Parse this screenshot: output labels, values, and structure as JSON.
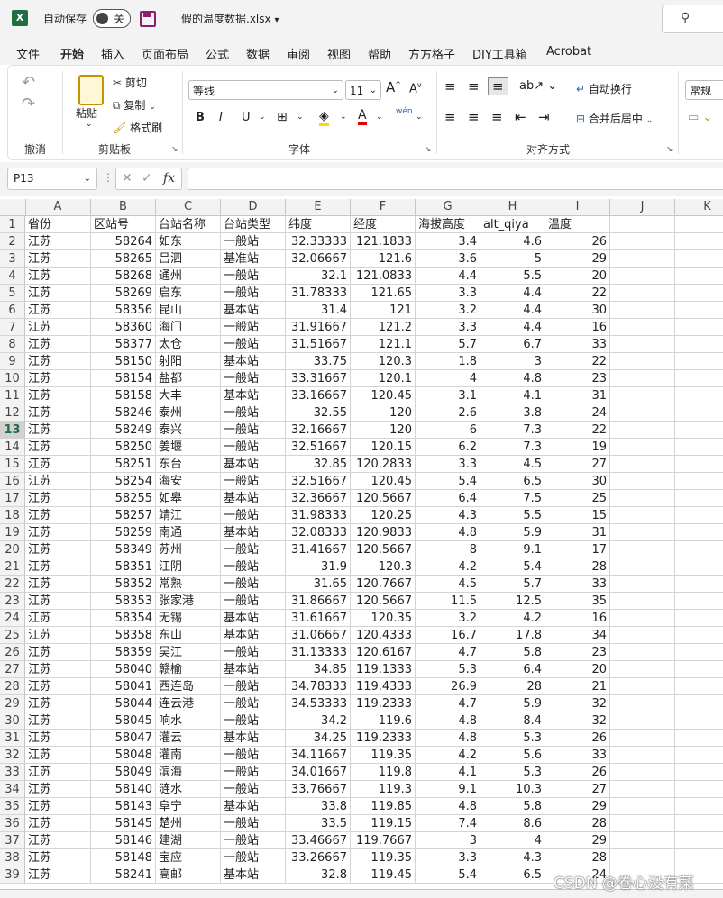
{
  "titlebar": {
    "app_icon": "X",
    "autosave_label": "自动保存",
    "autosave_state": "关",
    "filename": "假的温度数据.xlsx",
    "filename_dropdown": "▾",
    "search_icon": "⚲"
  },
  "menu_tabs": [
    "文件",
    "开始",
    "插入",
    "页面布局",
    "公式",
    "数据",
    "审阅",
    "视图",
    "帮助",
    "方方格子",
    "DIY工具箱",
    "Acrobat"
  ],
  "active_tab": "开始",
  "ribbon": {
    "undo_group": "撤消",
    "clipboard": {
      "paste": "粘贴",
      "cut": "剪切",
      "copy": "复制",
      "format_painter": "格式刷",
      "label": "剪贴板"
    },
    "font": {
      "name": "等线",
      "size": "11",
      "label": "字体",
      "bold": "B",
      "italic": "I",
      "underline": "U",
      "wen": "wén"
    },
    "alignment": {
      "wrap": "自动换行",
      "merge": "合并后居中",
      "label": "对齐方式"
    },
    "number": {
      "format": "常规"
    }
  },
  "formula_bar": {
    "name_box": "P13",
    "fx": "fx",
    "formula": ""
  },
  "columns": [
    "A",
    "B",
    "C",
    "D",
    "E",
    "F",
    "G",
    "H",
    "I",
    "J",
    "K"
  ],
  "selected_row": 13,
  "header_row": [
    "省份",
    "区站号",
    "台站名称",
    "台站类型",
    "纬度",
    "经度",
    "海拔高度",
    "alt_qiya",
    "温度"
  ],
  "rows": [
    [
      "江苏",
      "58264",
      "如东",
      "一般站",
      "32.33333",
      "121.1833",
      "3.4",
      "4.6",
      "26"
    ],
    [
      "江苏",
      "58265",
      "吕泗",
      "基准站",
      "32.06667",
      "121.6",
      "3.6",
      "5",
      "29"
    ],
    [
      "江苏",
      "58268",
      "通州",
      "一般站",
      "32.1",
      "121.0833",
      "4.4",
      "5.5",
      "20"
    ],
    [
      "江苏",
      "58269",
      "启东",
      "一般站",
      "31.78333",
      "121.65",
      "3.3",
      "4.4",
      "22"
    ],
    [
      "江苏",
      "58356",
      "昆山",
      "基本站",
      "31.4",
      "121",
      "3.2",
      "4.4",
      "30"
    ],
    [
      "江苏",
      "58360",
      "海门",
      "一般站",
      "31.91667",
      "121.2",
      "3.3",
      "4.4",
      "16"
    ],
    [
      "江苏",
      "58377",
      "太仓",
      "一般站",
      "31.51667",
      "121.1",
      "5.7",
      "6.7",
      "33"
    ],
    [
      "江苏",
      "58150",
      "射阳",
      "基本站",
      "33.75",
      "120.3",
      "1.8",
      "3",
      "22"
    ],
    [
      "江苏",
      "58154",
      "盐都",
      "一般站",
      "33.31667",
      "120.1",
      "4",
      "4.8",
      "23"
    ],
    [
      "江苏",
      "58158",
      "大丰",
      "基本站",
      "33.16667",
      "120.45",
      "3.1",
      "4.1",
      "31"
    ],
    [
      "江苏",
      "58246",
      "泰州",
      "一般站",
      "32.55",
      "120",
      "2.6",
      "3.8",
      "24"
    ],
    [
      "江苏",
      "58249",
      "泰兴",
      "一般站",
      "32.16667",
      "120",
      "6",
      "7.3",
      "22"
    ],
    [
      "江苏",
      "58250",
      "姜堰",
      "一般站",
      "32.51667",
      "120.15",
      "6.2",
      "7.3",
      "19"
    ],
    [
      "江苏",
      "58251",
      "东台",
      "基本站",
      "32.85",
      "120.2833",
      "3.3",
      "4.5",
      "27"
    ],
    [
      "江苏",
      "58254",
      "海安",
      "一般站",
      "32.51667",
      "120.45",
      "5.4",
      "6.5",
      "30"
    ],
    [
      "江苏",
      "58255",
      "如皋",
      "基本站",
      "32.36667",
      "120.5667",
      "6.4",
      "7.5",
      "25"
    ],
    [
      "江苏",
      "58257",
      "靖江",
      "一般站",
      "31.98333",
      "120.25",
      "4.3",
      "5.5",
      "15"
    ],
    [
      "江苏",
      "58259",
      "南通",
      "基本站",
      "32.08333",
      "120.9833",
      "4.8",
      "5.9",
      "31"
    ],
    [
      "江苏",
      "58349",
      "苏州",
      "一般站",
      "31.41667",
      "120.5667",
      "8",
      "9.1",
      "17"
    ],
    [
      "江苏",
      "58351",
      "江阴",
      "一般站",
      "31.9",
      "120.3",
      "4.2",
      "5.4",
      "28"
    ],
    [
      "江苏",
      "58352",
      "常熟",
      "一般站",
      "31.65",
      "120.7667",
      "4.5",
      "5.7",
      "33"
    ],
    [
      "江苏",
      "58353",
      "张家港",
      "一般站",
      "31.86667",
      "120.5667",
      "11.5",
      "12.5",
      "35"
    ],
    [
      "江苏",
      "58354",
      "无锡",
      "基本站",
      "31.61667",
      "120.35",
      "3.2",
      "4.2",
      "16"
    ],
    [
      "江苏",
      "58358",
      "东山",
      "基本站",
      "31.06667",
      "120.4333",
      "16.7",
      "17.8",
      "34"
    ],
    [
      "江苏",
      "58359",
      "吴江",
      "一般站",
      "31.13333",
      "120.6167",
      "4.7",
      "5.8",
      "23"
    ],
    [
      "江苏",
      "58040",
      "赣榆",
      "基本站",
      "34.85",
      "119.1333",
      "5.3",
      "6.4",
      "20"
    ],
    [
      "江苏",
      "58041",
      "西连岛",
      "一般站",
      "34.78333",
      "119.4333",
      "26.9",
      "28",
      "21"
    ],
    [
      "江苏",
      "58044",
      "连云港",
      "一般站",
      "34.53333",
      "119.2333",
      "4.7",
      "5.9",
      "32"
    ],
    [
      "江苏",
      "58045",
      "响水",
      "一般站",
      "34.2",
      "119.6",
      "4.8",
      "8.4",
      "32"
    ],
    [
      "江苏",
      "58047",
      "灌云",
      "基本站",
      "34.25",
      "119.2333",
      "4.8",
      "5.3",
      "26"
    ],
    [
      "江苏",
      "58048",
      "灌南",
      "一般站",
      "34.11667",
      "119.35",
      "4.2",
      "5.6",
      "33"
    ],
    [
      "江苏",
      "58049",
      "滨海",
      "一般站",
      "34.01667",
      "119.8",
      "4.1",
      "5.3",
      "26"
    ],
    [
      "江苏",
      "58140",
      "涟水",
      "一般站",
      "33.76667",
      "119.3",
      "9.1",
      "10.3",
      "27"
    ],
    [
      "江苏",
      "58143",
      "阜宁",
      "基本站",
      "33.8",
      "119.85",
      "4.8",
      "5.8",
      "29"
    ],
    [
      "江苏",
      "58145",
      "楚州",
      "一般站",
      "33.5",
      "119.15",
      "7.4",
      "8.6",
      "28"
    ],
    [
      "江苏",
      "58146",
      "建湖",
      "一般站",
      "33.46667",
      "119.7667",
      "3",
      "4",
      "29"
    ],
    [
      "江苏",
      "58148",
      "宝应",
      "一般站",
      "33.26667",
      "119.35",
      "3.3",
      "4.3",
      "28"
    ],
    [
      "江苏",
      "58241",
      "高邮",
      "基本站",
      "32.8",
      "119.45",
      "5.4",
      "6.5",
      "24"
    ]
  ],
  "watermark": "CSDN @卷心没有菜"
}
